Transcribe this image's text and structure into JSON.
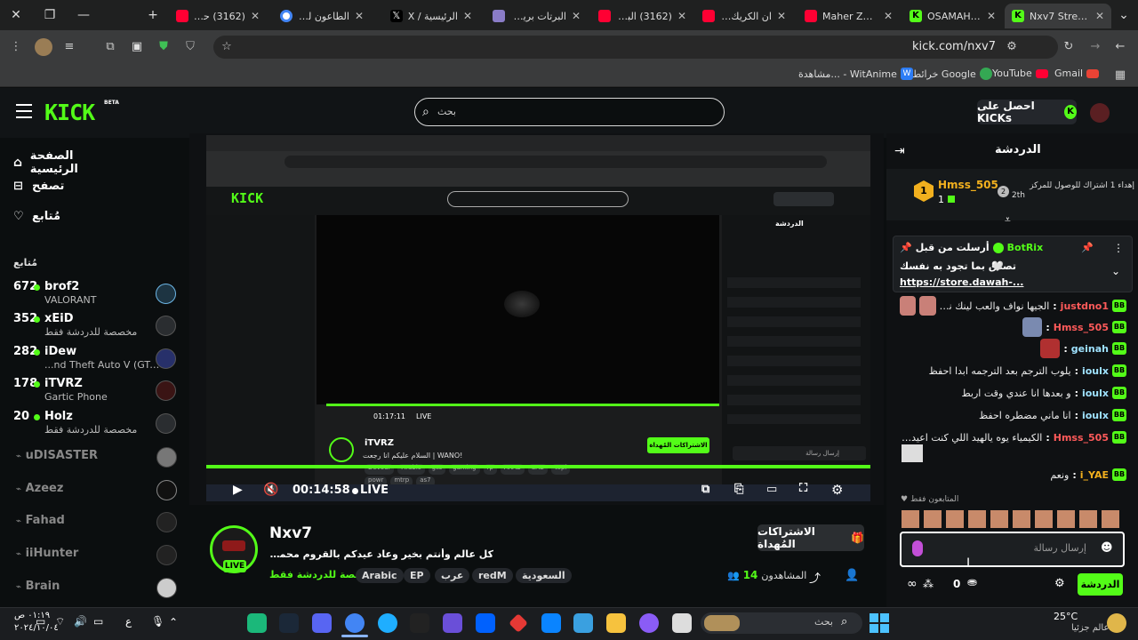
{
  "browser": {
    "tabs": [
      {
        "label": "Nxv7 Stream",
        "active": true,
        "favicon": "kick-icon",
        "color": "#53fc18"
      },
      {
        "label": "OSAMAH Stre",
        "favicon": "kick-icon",
        "color": "#53fc18"
      },
      {
        "label": "Maher Zain & ",
        "favicon": "youtube-icon",
        "color": "#ff0033"
      },
      {
        "label": "ان الكريك اكبر",
        "favicon": "youtube-icon",
        "color": "#ff0033"
      },
      {
        "label": "(3162) البرت",
        "favicon": "youtube-icon",
        "color": "#ff0033"
      },
      {
        "label": "البرتات بريمي",
        "favicon": "image-icon",
        "color": "#8a7cc7"
      },
      {
        "label": "الرئيسية / X",
        "favicon": "x-icon",
        "color": "#000000"
      },
      {
        "label": "الطاعون لعبة",
        "favicon": "google-icon",
        "color": "#4285f4"
      },
      {
        "label": "(3162) حروف",
        "favicon": "youtube-icon",
        "color": "#ff0033"
      }
    ],
    "url": "kick.com/nxv7",
    "bookmarks": [
      "Gmail",
      "YouTube",
      "خرائط Google",
      "مشاهدة... - WitAnime"
    ]
  },
  "header": {
    "logo": "KICK",
    "beta": "BETA",
    "search_placeholder": "بحث",
    "get_kicks": "احصل على KICKs"
  },
  "sidebar": {
    "nav": [
      "الصفحة الرئيسية",
      "تصفح",
      "مُتابع"
    ],
    "following_title": "مُتابع",
    "following": [
      {
        "name": "brof2",
        "viewers": "672",
        "category": "VALORANT"
      },
      {
        "name": "xEiD",
        "viewers": "352",
        "category": "مخصصة للدردشة فقط"
      },
      {
        "name": "iDew",
        "viewers": "282",
        "category": "...nd Theft Auto V (GTA)"
      },
      {
        "name": "iTVRZ",
        "viewers": "178",
        "category": "Gartic Phone"
      },
      {
        "name": "Holz",
        "viewers": "20",
        "category": "مخصصة للدردشة فقط"
      }
    ],
    "offline": [
      "uDISASTER",
      "Azeez",
      "Fahad",
      "iiHunter",
      "Brain"
    ]
  },
  "player": {
    "time": "00:14:58",
    "live": "LIVE",
    "inner": {
      "channel": "iTVRZ",
      "title": "السلام عليكم انا رجعت | WANO!",
      "time": "01:17:11",
      "live": "LIVE",
      "tags": [
        "Devour",
        "Arabic",
        "gta",
        "gaming",
        "rp",
        "ARAB",
        "SAB",
        "topi",
        "powr",
        "mtrp",
        "as7"
      ],
      "gift": "الاشتراكات المُهداة",
      "chat_title": "الدردشة",
      "chat_send": "إرسال رسالة"
    }
  },
  "channel": {
    "name": "Nxv7",
    "title": "كل عالم وأنتم بخير وعاد عيدكم بالقروم محمد | EP - !MT!",
    "category": "مخصصة للدردشة فقط",
    "live": "LIVE",
    "tags": [
      "السعودية",
      "redM",
      "عرب",
      "EP",
      "Arabic"
    ],
    "viewers": "14",
    "viewers_label": "المشاهدون",
    "gift_button": "الاشتراكات المُهداة"
  },
  "chat": {
    "title": "الدردشة",
    "leader_name": "Hmss_505",
    "leader_count": "1",
    "leader_rank": "2",
    "leader_note": "إهداء 1 اشتراك للوصول للمركز",
    "leader_note2": "2th",
    "pinned_by": "أرسلت من قبل",
    "pinned_user": "BotRix",
    "pinned_text": "تصدق بما تجود به نفسك",
    "pinned_link": "https://store.dawah-...",
    "messages": [
      {
        "user": "justdno1",
        "text": "الجيها نواف والعب لينك نايت مير"
      },
      {
        "user": "Hmss_505",
        "text": ""
      },
      {
        "user": "geinah",
        "text": ""
      },
      {
        "user": "ioulx",
        "text": "يلوب الترجم بعد الترجمه ابدا احفظ"
      },
      {
        "user": "ioulx",
        "text": "و بعدها انا عندي وقت اربط"
      },
      {
        "user": "ioulx",
        "text": "انا ماني مضطره احفظ"
      },
      {
        "user": "Hmss_505",
        "text": "الكيمياء يوه يالهيد اللي كنت اعيده بالربط"
      },
      {
        "user": "i_YAE",
        "text": "ونعم"
      }
    ],
    "subs_only": "المتابعون فقط",
    "input_placeholder": "إرسال رسالة",
    "send_label": "الدردشة",
    "points": "0"
  },
  "taskbar": {
    "search_placeholder": "بحث",
    "weather_temp": "25°C",
    "weather_text": "عالم جزئيا",
    "time": "٠١:١٩ ص",
    "date": "٢٠٢٤/١٠/٠٤",
    "lang": "ع"
  },
  "colors": {
    "accent": "#53fc18",
    "bg": "#0b0e0f",
    "panel": "#111416"
  }
}
